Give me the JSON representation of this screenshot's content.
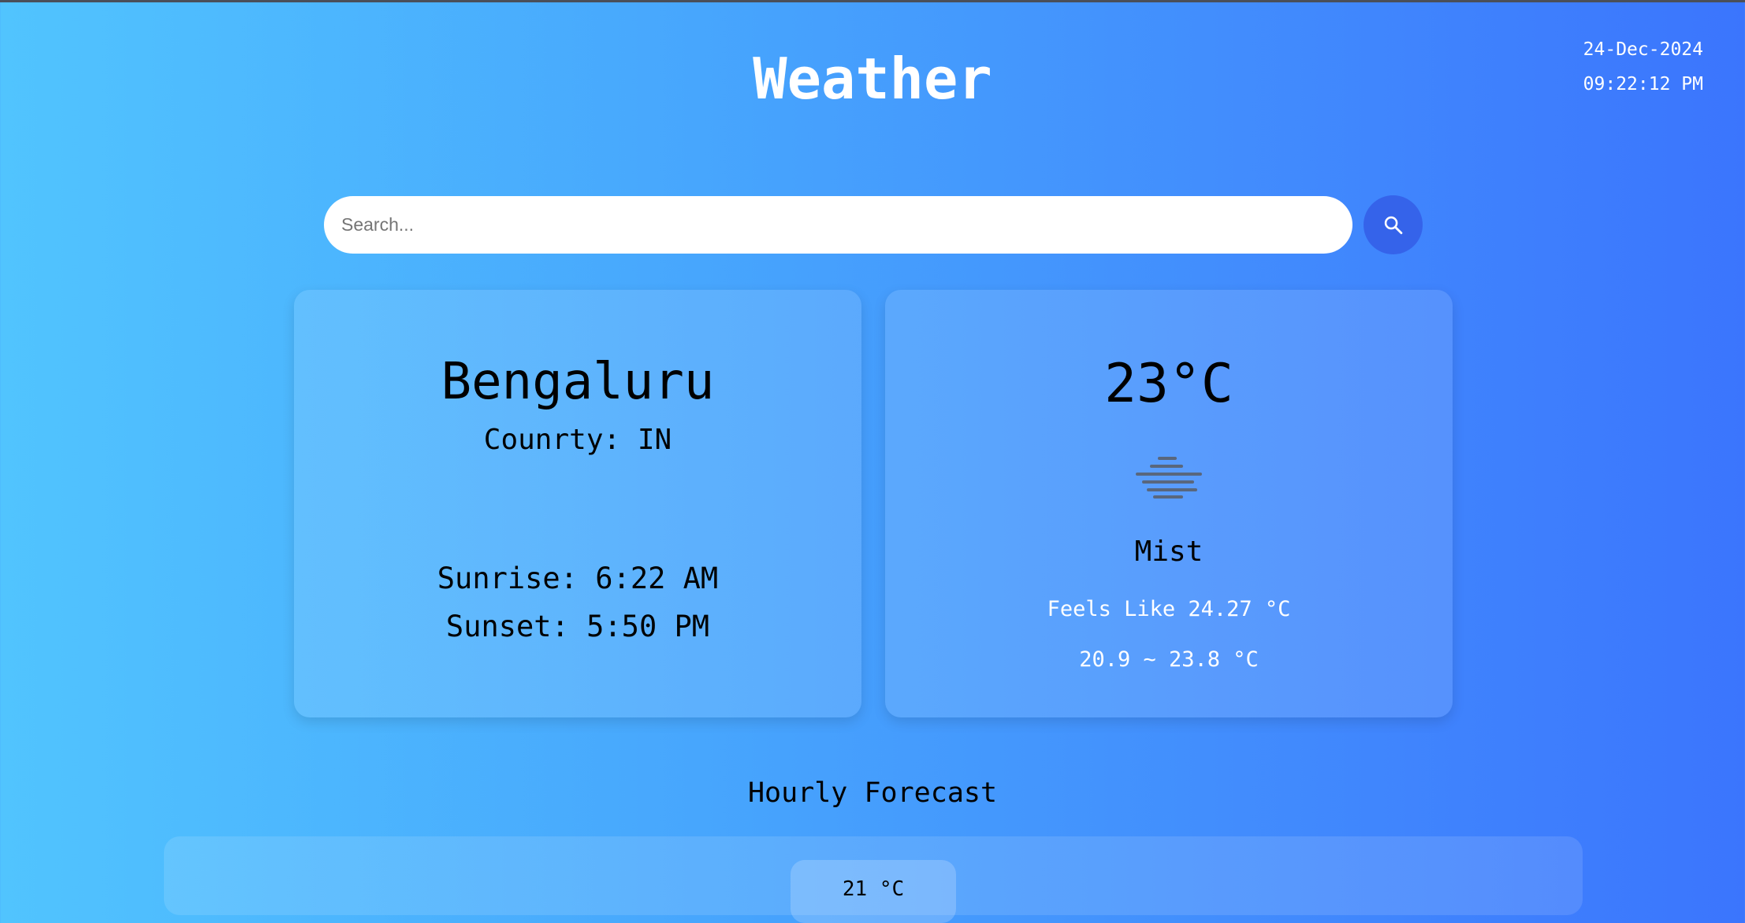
{
  "header": {
    "title": "Weather",
    "date": "24-Dec-2024",
    "time": "09:22:12 PM"
  },
  "search": {
    "placeholder": "Search...",
    "value": "",
    "button_icon": "search-icon"
  },
  "location_card": {
    "city": "Bengaluru",
    "country": "Counrty: IN",
    "sunrise": "Sunrise: 6:22 AM",
    "sunset": "Sunset: 5:50 PM"
  },
  "weather_card": {
    "temperature": "23°C",
    "condition_icon": "mist-icon",
    "condition": "Mist",
    "feels_like": "Feels Like 24.27 °C",
    "range": "20.9 ~ 23.8 °C"
  },
  "hourly": {
    "title": "Hourly Forecast",
    "items": [
      {
        "temp": "21 °C"
      }
    ]
  },
  "colors": {
    "gradient_start": "#51c4fe",
    "gradient_end": "#3b75fd",
    "search_button": "#3563ea"
  }
}
